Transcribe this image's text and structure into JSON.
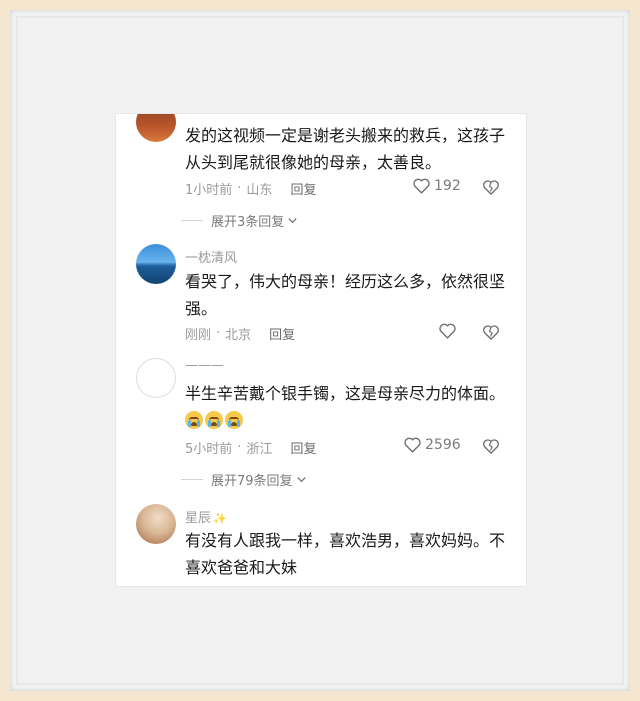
{
  "comments": [
    {
      "username": "",
      "text": "发的这视频一定是谢老头搬来的救兵，这孩子从头到尾就很像她的母亲，太善良。",
      "time": "1小时前",
      "location": "山东",
      "reply_label": "回复",
      "likes": "192",
      "expand_label": "展开3条回复"
    },
    {
      "username": "一枕清风",
      "text": "看哭了，伟大的母亲！经历这么多，依然很坚强。",
      "time": "刚刚",
      "location": "北京",
      "reply_label": "回复",
      "likes": ""
    },
    {
      "username": "———",
      "text": "半生辛苦戴个银手镯，这是母亲尽力的体面。",
      "emoji_count": 3,
      "time": "5小时前",
      "location": "浙江",
      "reply_label": "回复",
      "likes": "2596",
      "expand_label": "展开79条回复"
    },
    {
      "username": "星辰",
      "username_suffix": "✨",
      "text": "有没有人跟我一样，喜欢浩男，喜欢妈妈。不喜欢爸爸和大妹"
    }
  ],
  "meta_separator": "·",
  "colors": {
    "text": "#1a1a1a",
    "meta": "#9b9b9b",
    "frame": "#f5e6cf"
  },
  "icons": {
    "like": "heart-outline-icon",
    "dislike": "broken-heart-icon",
    "expand": "chevron-down-icon"
  }
}
